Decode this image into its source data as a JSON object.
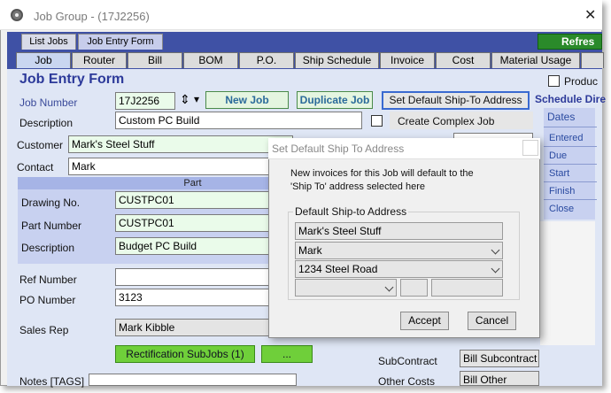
{
  "window": {
    "title": "Job Group -  (17J2256)",
    "close_glyph": "✕"
  },
  "top_tabs": {
    "list_jobs": "List Jobs",
    "job_entry_form": "Job Entry Form",
    "refresh": "Refres"
  },
  "sub_tabs": [
    "Job",
    "Router",
    "Bill",
    "BOM",
    "P.O.",
    "Ship Schedule",
    "Invoice",
    "Cost",
    "Material Usage"
  ],
  "form": {
    "title": "Job Entry Form",
    "job_number_label": "Job Number",
    "job_number_value": "17J2256",
    "spinner_glyph": "⇕",
    "dropdown_glyph": "▾",
    "new_job": "New Job",
    "duplicate_job": "Duplicate Job",
    "set_default_ship": "Set Default Ship-To Address",
    "product_label": "Produc",
    "schedule_dir": "Schedule Dire",
    "description_label": "Description",
    "description_value": "Custom PC Build",
    "create_complex_job": "Create Complex Job",
    "customer_label": "Customer",
    "customer_value": "Mark's Steel Stuff",
    "contact_label": "Contact",
    "contact_value": "Mark",
    "part_header": "Part",
    "drawing_label": "Drawing No.",
    "drawing_value": "CUSTPC01",
    "part_number_label": "Part Number",
    "part_number_value": "CUSTPC01",
    "part_desc_label": "Description",
    "part_desc_value": "Budget PC Build",
    "ref_number_label": "Ref Number",
    "ref_number_value": "",
    "po_number_label": "PO Number",
    "po_number_value": "3123",
    "sales_rep_label": "Sales Rep",
    "sales_rep_value": "Mark Kibble",
    "rectification": "Rectification SubJobs (1)",
    "second_btn": "...",
    "notes_label": "Notes [TAGS]",
    "subcontract_label": "SubContract",
    "subcontract_value": "Bill Subcontract",
    "other_costs_label": "Other Costs",
    "other_costs_value": "Bill Other"
  },
  "dates": {
    "title": "Dates",
    "items": [
      "Entered",
      "Due",
      "Start",
      "Finish",
      "Close"
    ]
  },
  "dialog": {
    "title": "Set Default Ship To Address",
    "message_line1": "New invoices for this Job will default to the",
    "message_line2": "'Ship To' address selected here",
    "group_label": "Default Ship-to Address",
    "company": "Mark's Steel Stuff",
    "contact": "Mark",
    "address": "1234 Steel Road",
    "accept": "Accept",
    "cancel": "Cancel"
  }
}
